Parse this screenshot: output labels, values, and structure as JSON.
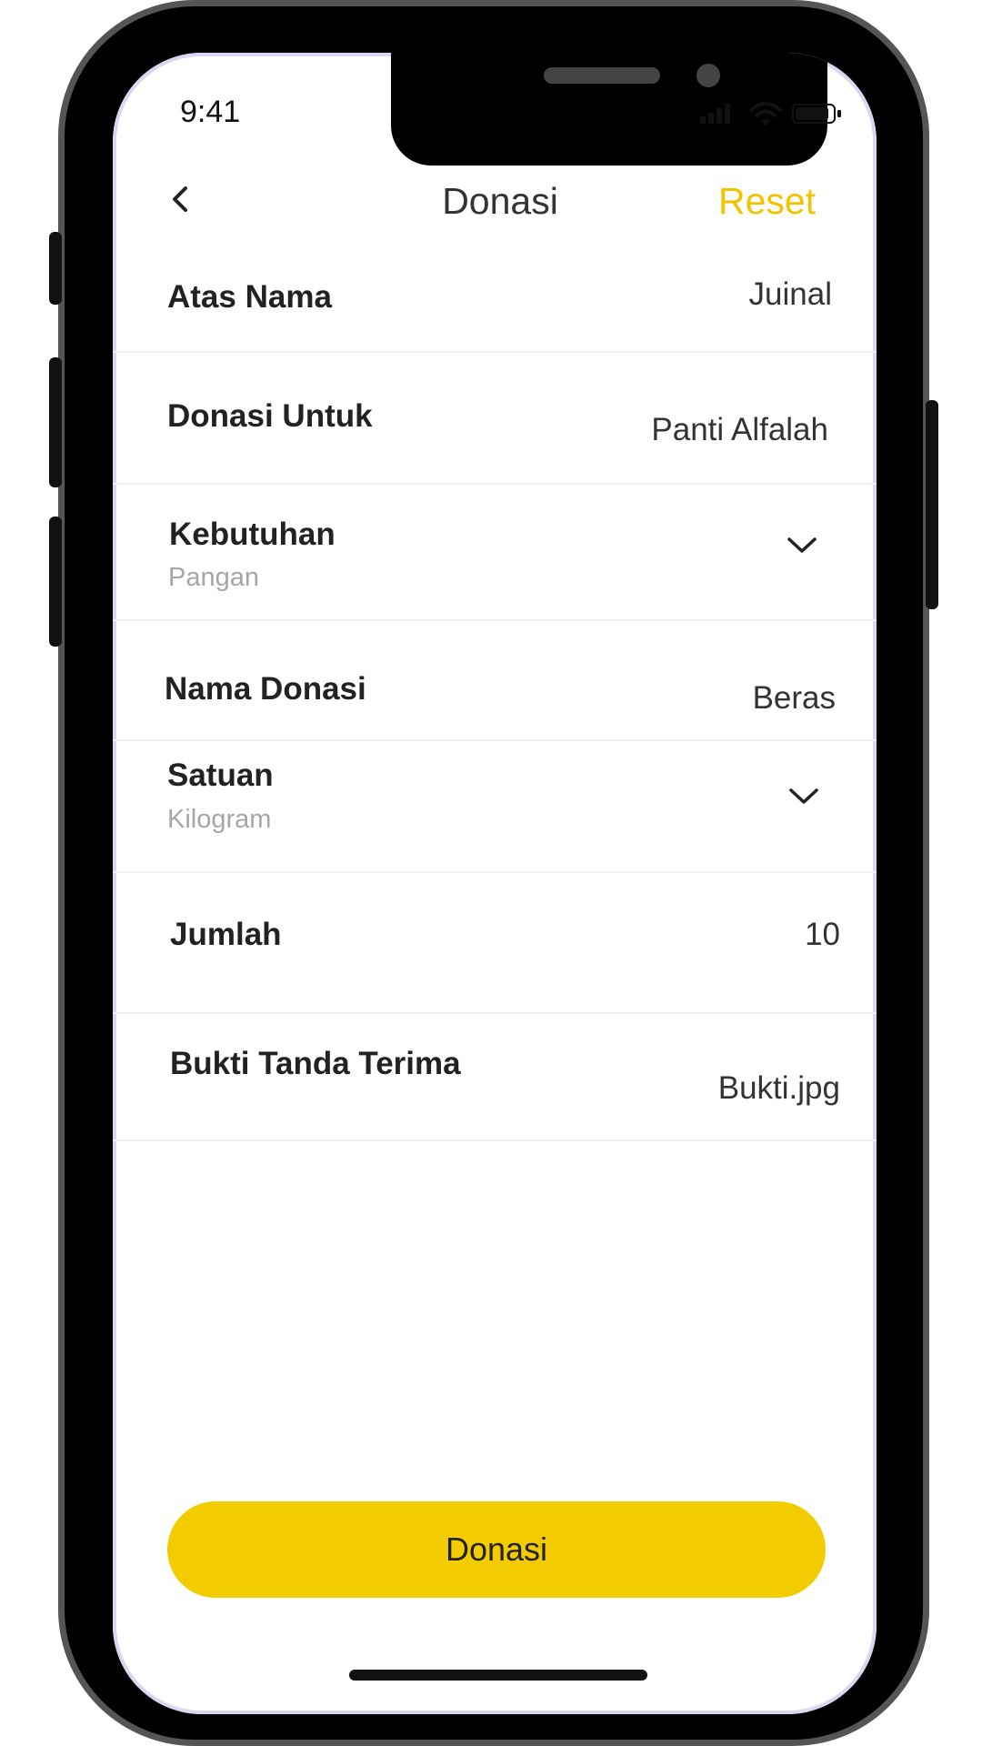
{
  "status_bar": {
    "time": "9:41"
  },
  "header": {
    "title": "Donasi",
    "reset_label": "Reset"
  },
  "form": {
    "atas_nama": {
      "label": "Atas Nama",
      "value": "Juinal"
    },
    "donasi_untuk": {
      "label": "Donasi Untuk",
      "value": "Panti Alfalah"
    },
    "kebutuhan": {
      "label": "Kebutuhan",
      "value": "Pangan"
    },
    "nama_donasi": {
      "label": "Nama Donasi",
      "value": "Beras"
    },
    "satuan": {
      "label": "Satuan",
      "value": "Kilogram"
    },
    "jumlah": {
      "label": "Jumlah",
      "value": "10"
    },
    "bukti": {
      "label": "Bukti Tanda Terima",
      "value": "Bukti.jpg"
    }
  },
  "submit": {
    "label": "Donasi"
  },
  "colors": {
    "accent": "#f2cc00",
    "reset": "#f5c200"
  }
}
